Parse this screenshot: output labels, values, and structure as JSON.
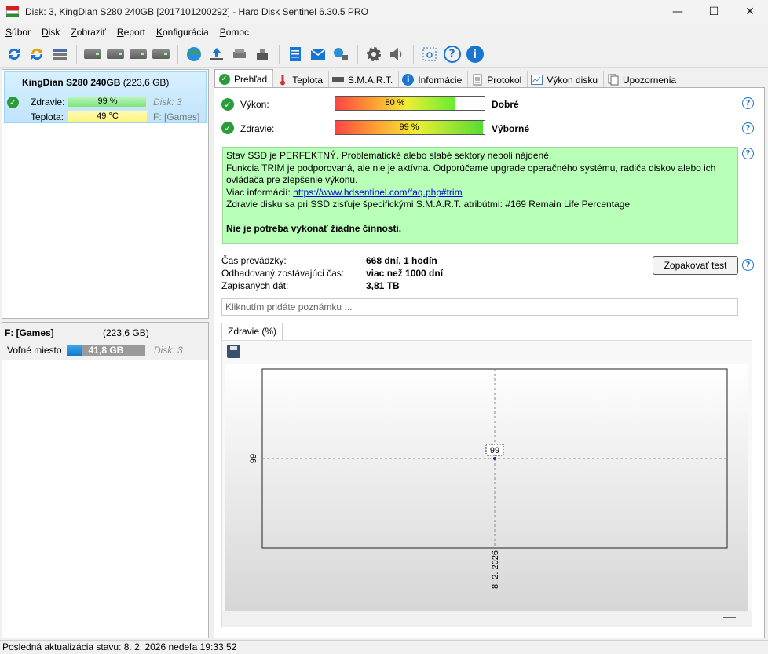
{
  "window": {
    "title": "Disk: 3, KingDian S280 240GB [2017101200292]  -  Hard Disk Sentinel 6.30.5 PRO"
  },
  "window_buttons": {
    "minimize": "—",
    "maximize": "☐",
    "close": "✕"
  },
  "menu": [
    {
      "label": "Súbor",
      "key": "S",
      "rest": "úbor"
    },
    {
      "label": "Disk",
      "key": "D",
      "rest": "isk"
    },
    {
      "label": "Zobraziť",
      "key": "Z",
      "rest": "obraziť"
    },
    {
      "label": "Report",
      "key": "R",
      "rest": "eport"
    },
    {
      "label": "Konfigurácia",
      "key": "K",
      "rest": "onfigurácia"
    },
    {
      "label": "Pomoc",
      "key": "P",
      "rest": "omoc"
    }
  ],
  "toolbar": {
    "icons": [
      "refresh-icon",
      "refresh-all-icon",
      "disk-list-icon",
      "disk-icon",
      "disk-schedule-icon",
      "disk-check-icon",
      "disk-search-icon",
      "globe-icon",
      "upload-icon",
      "drive-icon",
      "usb-drive-icon",
      "notepad-icon",
      "mail-icon",
      "network-icon",
      "settings-icon",
      "speaker-icon",
      "screenshot-icon",
      "help-icon",
      "info-icon"
    ]
  },
  "disk": {
    "name": "KingDian S280 240GB",
    "capacity": "(223,6 GB)",
    "health_label": "Zdravie:",
    "health_value": "99 %",
    "health_fraction": 0.99,
    "disk_label": "Disk: 3",
    "temp_label": "Teplota:",
    "temp_value": "49 °C",
    "partition_ref": "F: [Games]"
  },
  "partition": {
    "name": "F: [Games]",
    "capacity": "(223,6 GB)",
    "free_label": "Voľné miesto",
    "free_value": "41,8 GB",
    "free_fraction": 0.187,
    "disk_label": "Disk: 3"
  },
  "tabs": [
    {
      "label": "Prehľad",
      "icon": "check-circle-icon",
      "active": true
    },
    {
      "label": "Teplota",
      "icon": "thermometer-icon",
      "active": false
    },
    {
      "label": "S.M.A.R.T.",
      "icon": "smart-icon",
      "active": false
    },
    {
      "label": "Informácie",
      "icon": "info-icon",
      "active": false
    },
    {
      "label": "Protokol",
      "icon": "log-icon",
      "active": false
    },
    {
      "label": "Výkon disku",
      "icon": "performance-chart-icon",
      "active": false
    },
    {
      "label": "Upozornenia",
      "icon": "alerts-icon",
      "active": false
    }
  ],
  "overview": {
    "performance": {
      "label": "Výkon:",
      "value": "80 %",
      "fraction": 0.8,
      "verdict": "Dobré"
    },
    "health": {
      "label": "Zdravie:",
      "value": "99 %",
      "fraction": 0.99,
      "verdict": "Výborné"
    },
    "status_lines": [
      "Stav SSD je PERFEKTNÝ. Problematické alebo slabé sektory neboli nájdené.",
      "Funkcia TRIM je podporovaná, ale nie je aktívna. Odporúčame upgrade operačného systému, radiča diskov alebo ich ovládača pre zlepšenie výkonu."
    ],
    "more_info_label": "Viac informácií: ",
    "more_info_link": "https://www.hdsentinel.com/faq.php#trim",
    "smart_line": "Zdravie disku sa pri SSD zisťuje špecifickými S.M.A.R.T. atribútmi:  #169 Remain Life Percentage",
    "action_line": "Nie je potreba vykonať žiadne činnosti.",
    "uptime_label": "Čas prevádzky:",
    "uptime_value": "668 dní, 1 hodín",
    "remaining_label": "Odhadovaný zostávajúci čas:",
    "remaining_value": "viac než 1000 dní",
    "written_label": "Zapísaných dát:",
    "written_value": "3,81 TB",
    "retest_button": "Zopakovať test",
    "note_placeholder": "Kliknutím pridáte poznámku ..."
  },
  "chart_tab": "Zdravie (%)",
  "chart_data": {
    "type": "line",
    "title": "",
    "x": [
      "8. 2. 2026"
    ],
    "series": [
      {
        "values": [
          99
        ]
      }
    ],
    "point_labels": [
      "99"
    ],
    "y_tick_labels": [
      "99"
    ],
    "x_tick_labels": [
      "8. 2. 2026"
    ],
    "grid": true
  },
  "status_bar": {
    "text": "Posledná aktualizácia stavu: 8. 2. 2026 nedeľa 19:33:52"
  },
  "colors": {
    "accent_blue": "#1a75d1",
    "ok_green": "#2a9d3a",
    "status_bg": "#b8ffb8",
    "selected_disk_bg": "#c8eaff"
  }
}
